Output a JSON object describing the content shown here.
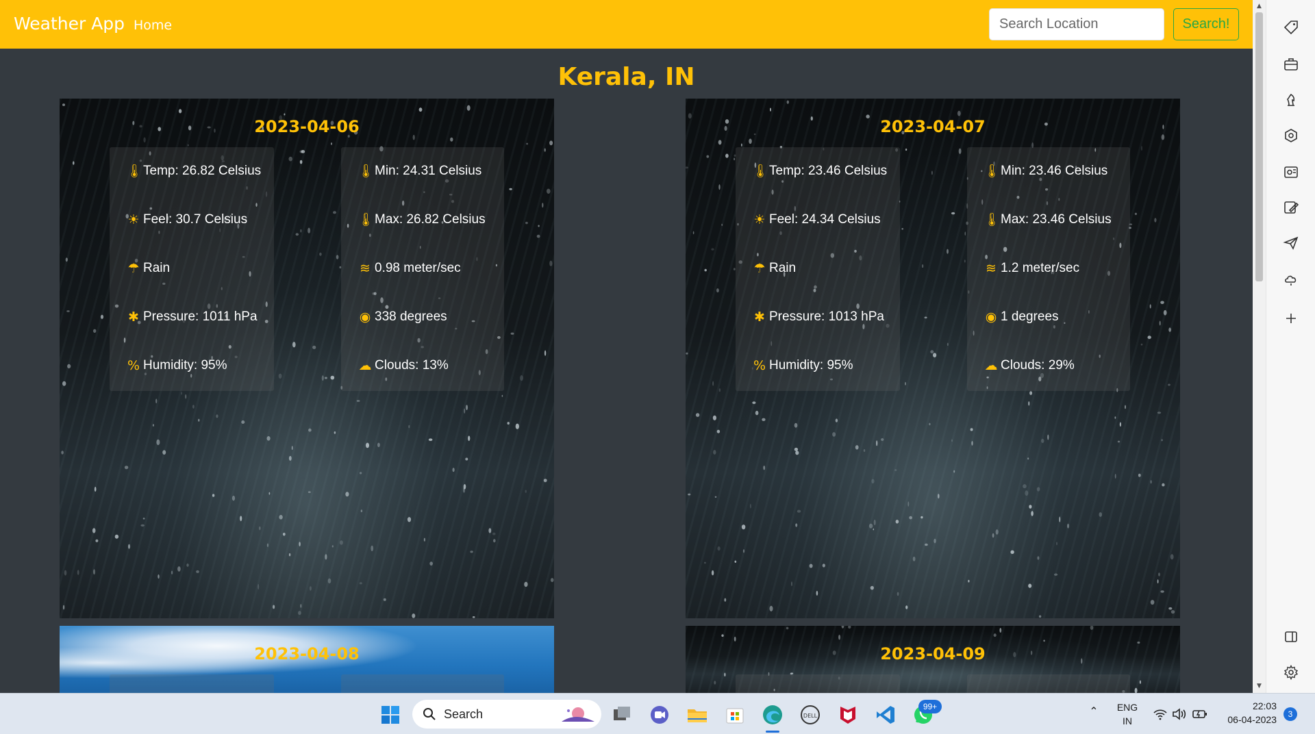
{
  "navbar": {
    "brand": "Weather App",
    "home_label": "Home",
    "search_placeholder": "Search Location",
    "search_button": "Search!"
  },
  "page": {
    "title": "Kerala, IN"
  },
  "forecast": [
    {
      "date": "2023-04-06",
      "theme": "rain",
      "left": [
        {
          "icon": "thermometer-icon",
          "text": "Temp: 26.82 Celsius"
        },
        {
          "icon": "feel-thermometer-icon",
          "text": "Feel: 30.7 Celsius"
        },
        {
          "icon": "rain-cloud-icon",
          "text": "Rain"
        },
        {
          "icon": "pressure-icon",
          "text": "Pressure: 1011 hPa"
        },
        {
          "icon": "percent-icon",
          "text": "Humidity: 95%"
        }
      ],
      "right": [
        {
          "icon": "thermometer-degree-icon",
          "text": "Min: 24.31 Celsius"
        },
        {
          "icon": "thermometer-degree-icon",
          "text": "Max: 26.82 Celsius"
        },
        {
          "icon": "wind-icon",
          "text": "0.98 meter/sec"
        },
        {
          "icon": "compass-icon",
          "text": "338 degrees"
        },
        {
          "icon": "cloud-icon",
          "text": "Clouds: 13%"
        }
      ]
    },
    {
      "date": "2023-04-07",
      "theme": "rain",
      "left": [
        {
          "icon": "thermometer-icon",
          "text": "Temp: 23.46 Celsius"
        },
        {
          "icon": "feel-thermometer-icon",
          "text": "Feel: 24.34 Celsius"
        },
        {
          "icon": "rain-cloud-icon",
          "text": "Rain"
        },
        {
          "icon": "pressure-icon",
          "text": "Pressure: 1013 hPa"
        },
        {
          "icon": "percent-icon",
          "text": "Humidity: 95%"
        }
      ],
      "right": [
        {
          "icon": "thermometer-degree-icon",
          "text": "Min: 23.46 Celsius"
        },
        {
          "icon": "thermometer-degree-icon",
          "text": "Max: 23.46 Celsius"
        },
        {
          "icon": "wind-icon",
          "text": "1.2 meter/sec"
        },
        {
          "icon": "compass-icon",
          "text": "1 degrees"
        },
        {
          "icon": "cloud-icon",
          "text": "Clouds: 29%"
        }
      ]
    },
    {
      "date": "2023-04-08",
      "theme": "sky"
    },
    {
      "date": "2023-04-09",
      "theme": "rain"
    }
  ],
  "edge_sidebar": {
    "icons": [
      "tag-icon",
      "briefcase-icon",
      "chess-icon",
      "copilot-icon",
      "outlook-icon",
      "designer-icon",
      "send-icon",
      "cloud-drop-icon",
      "add-icon",
      "sidebar-toggle-icon",
      "settings-icon"
    ]
  },
  "taskbar": {
    "search_label": "Search",
    "language_primary": "ENG",
    "language_secondary": "IN",
    "time": "22:03",
    "date": "06-04-2023",
    "whatsapp_badge": "99+",
    "notification_count": "3",
    "apps": [
      "windows-start-icon",
      "task-view-icon",
      "teams-chat-icon",
      "file-explorer-icon",
      "store-icon",
      "edge-icon",
      "dell-icon",
      "mcafee-icon",
      "vscode-icon",
      "whatsapp-icon"
    ]
  },
  "colors": {
    "accent": "#ffc107",
    "page_bg": "#343a40",
    "search_button": "#28a745"
  }
}
